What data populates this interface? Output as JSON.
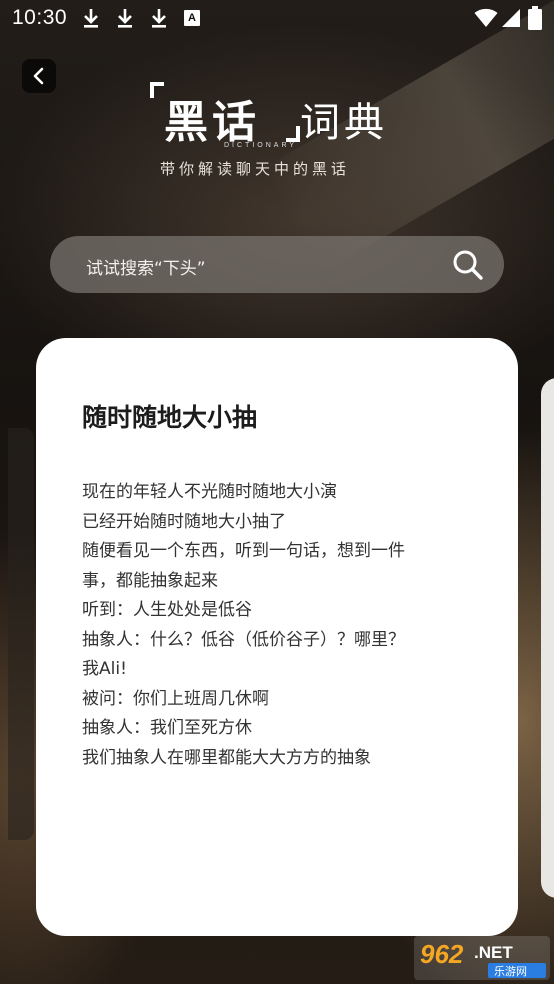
{
  "status_bar": {
    "time": "10:30",
    "icons": [
      "download-icon",
      "download-icon",
      "download-icon",
      "a-notification-icon",
      "wifi-icon",
      "signal-icon",
      "battery-icon"
    ],
    "a_badge": "A"
  },
  "header": {
    "logo_main": "黑话",
    "logo_secondary": "词典",
    "logo_english": "DICTIONARY",
    "tagline": "带你解读聊天中的黑话"
  },
  "search": {
    "placeholder": "试试搜索“下头”",
    "icon": "search-icon"
  },
  "card": {
    "title": "随时随地大小抽",
    "lines": [
      "现在的年轻人不光随时随地大小演",
      "已经开始随时随地大小抽了",
      "随便看见一个东西，听到一句话，想到一件",
      "事，都能抽象起来",
      "听到：人生处处是低谷",
      "抽象人：什么？低谷（低价谷子）？哪里？",
      "我Ali!",
      "被问：你们上班周几休啊",
      "抽象人：我们至死方休",
      "我们抽象人在哪里都能大大方方的抽象"
    ]
  },
  "watermark": {
    "number": "962",
    "suffix": ".NET",
    "caption": "乐游网"
  },
  "colors": {
    "background": "#1b1714",
    "card": "#ffffff",
    "search_bg": "#78736e"
  }
}
